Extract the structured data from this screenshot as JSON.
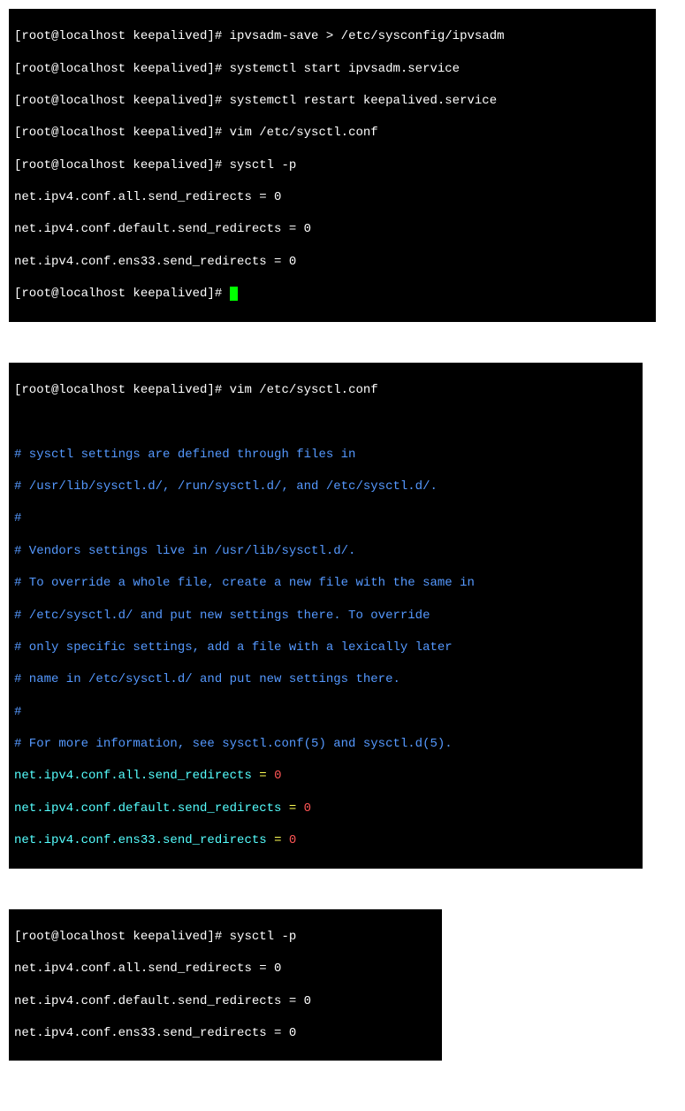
{
  "block1": {
    "prompt": "[root@localhost keepalived]# ",
    "cmd1": "ipvsadm-save > /etc/sysconfig/ipvsadm",
    "cmd2": "systemctl start ipvsadm.service",
    "cmd3": "systemctl restart keepalived.service",
    "cmd4": "vim /etc/sysctl.conf",
    "cmd5": "sysctl -p",
    "out1": "net.ipv4.conf.all.send_redirects = 0",
    "out2": "net.ipv4.conf.default.send_redirects = 0",
    "out3": "net.ipv4.conf.ens33.send_redirects = 0"
  },
  "block2": {
    "prompt": "[root@localhost keepalived]# ",
    "cmd": "vim /etc/sysctl.conf",
    "c1": "# sysctl settings are defined through files in",
    "c2": "# /usr/lib/sysctl.d/, /run/sysctl.d/, and /etc/sysctl.d/.",
    "c3": "#",
    "c4": "# Vendors settings live in /usr/lib/sysctl.d/.",
    "c5": "# To override a whole file, create a new file with the same in",
    "c6": "# /etc/sysctl.d/ and put new settings there. To override",
    "c7": "# only specific settings, add a file with a lexically later",
    "c8": "# name in /etc/sysctl.d/ and put new settings there.",
    "c9": "#",
    "c10": "# For more information, see sysctl.conf(5) and sysctl.d(5).",
    "k1": "net.ipv4.conf.all.send_redirects ",
    "k2": "net.ipv4.conf.default.send_redirects ",
    "k3": "net.ipv4.conf.ens33.send_redirects ",
    "eq": "=",
    "sp": " ",
    "v": "0"
  },
  "block3": {
    "prompt": "[root@localhost keepalived]# ",
    "cmd": "sysctl -p",
    "out1": "net.ipv4.conf.all.send_redirects = 0",
    "out2": "net.ipv4.conf.default.send_redirects = 0",
    "out3": "net.ipv4.conf.ens33.send_redirects = 0"
  }
}
